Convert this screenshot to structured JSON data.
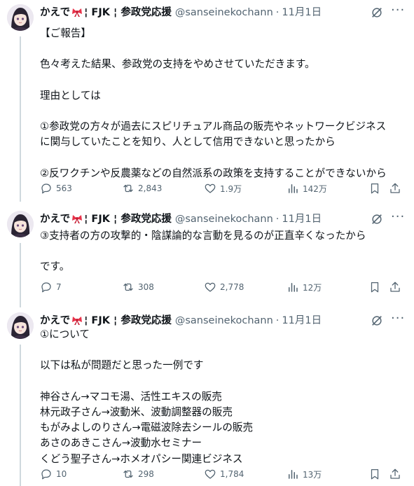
{
  "author": {
    "name_before": "かえで",
    "name_after": "¦ FJK ¦ 参政党応援",
    "handle": "@sanseinekochann",
    "separator": "·"
  },
  "tweets": [
    {
      "date": "11月1日",
      "lines": [
        "【ご報告】",
        "",
        "色々考えた結果、参政党の支持をやめさせていただきます。",
        "",
        "理由としては",
        "",
        "①参政党の方々が過去にスピリチュアル商品の販売やネットワークビジネス",
        "に関与していたことを知り、人として信用できないと思ったから",
        "",
        "②反ワクチンや反農薬などの自然派系の政策を支持することができないから"
      ],
      "replies": "563",
      "reposts": "2,843",
      "likes": "1.9万",
      "views": "142万"
    },
    {
      "date": "11月1日",
      "lines": [
        "③支持者の方の攻撃的・陰謀論的な言動を見るのが正直辛くなったから",
        "",
        "です。"
      ],
      "replies": "7",
      "reposts": "308",
      "likes": "2,778",
      "views": "12万"
    },
    {
      "date": "11月1日",
      "lines": [
        "①について",
        "",
        "以下は私が問題だと思った一例です",
        "",
        "神谷さん→マコモ湯、活性エキスの販売",
        "林元政子さん→波動米、波動調整器の販売",
        "もがみよしのりさん→電磁波除去シールの販売",
        "あさのあきこさん→波動水セミナー",
        "くどう聖子さん→ホメオパシー関連ビジネス"
      ],
      "replies": "10",
      "reposts": "298",
      "likes": "1,784",
      "views": "13万"
    }
  ],
  "icons": {
    "avatar": "avatar-image",
    "ribbon": "ribbon-emoji",
    "grok": "grok-icon",
    "more": "more-icon",
    "reply": "reply-icon",
    "repost": "repost-icon",
    "like": "heart-icon",
    "views": "views-icon",
    "bookmark": "bookmark-icon",
    "share": "share-icon"
  },
  "colors": {
    "text": "#0f1419",
    "secondary": "#536471",
    "thread_line": "#cfd9de",
    "ribbon": "#e8334a"
  }
}
